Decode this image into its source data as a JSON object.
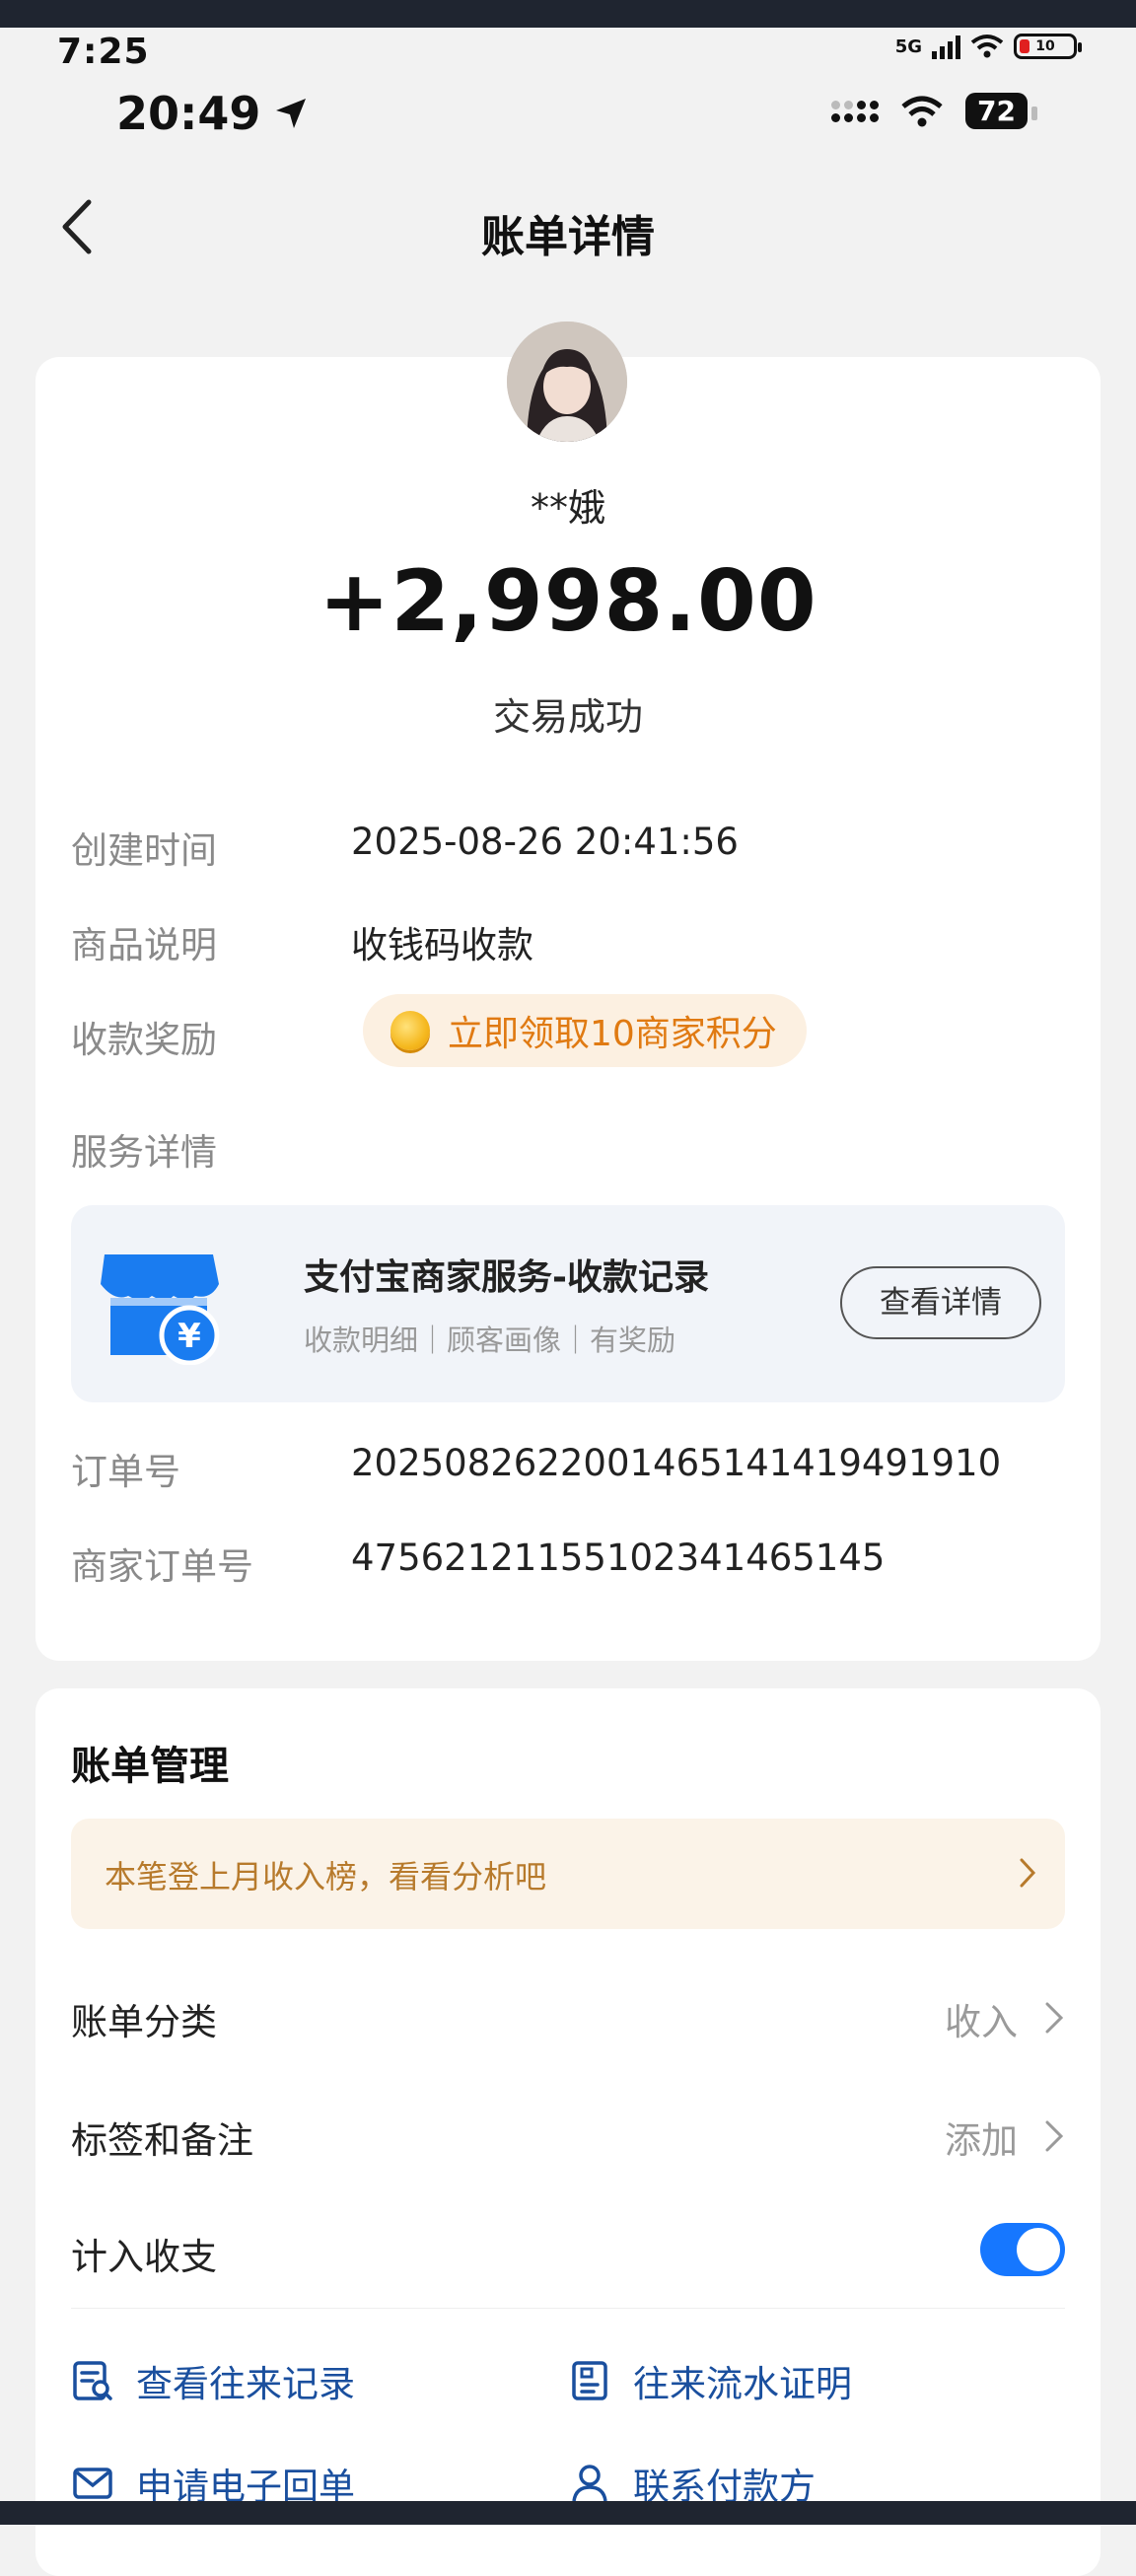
{
  "outer_status": {
    "time": "7:25",
    "network": "5G",
    "battery": "10"
  },
  "status_bar": {
    "time": "20:49",
    "battery": "72"
  },
  "nav": {
    "title": "账单详情"
  },
  "transaction": {
    "payee": "**娥",
    "amount": "+2,998.00",
    "status": "交易成功"
  },
  "details": {
    "created_label": "创建时间",
    "created_value": "2025-08-26 20:41:56",
    "desc_label": "商品说明",
    "desc_value": "收钱码收款",
    "reward_label": "收款奖励",
    "reward_value": "立即领取10商家积分",
    "service_label": "服务详情"
  },
  "service_card": {
    "title": "支付宝商家服务-收款记录",
    "subtitle": "收款明细｜顾客画像｜有奖励",
    "button": "查看详情"
  },
  "orders": {
    "order_label": "订单号",
    "order_value": "2025082622001465141419491910",
    "merchant_order_label": "商家订单号",
    "merchant_order_value": "4756212115510234146514​5"
  },
  "management": {
    "title": "账单管理",
    "tip": "本笔登上月收入榜，看看分析吧",
    "category_label": "账单分类",
    "category_value": "收入",
    "tags_label": "标签和备注",
    "tags_value": "添加",
    "count_label": "计入收支",
    "count_enabled": true
  },
  "links": {
    "history": "查看往来记录",
    "statement": "往来流水证明",
    "receipt": "申请电子回单",
    "contact": "联系付款方"
  },
  "colors": {
    "accent": "#1677ff",
    "reward_orange": "#e07a12",
    "link_blue": "#1a4f9e"
  }
}
